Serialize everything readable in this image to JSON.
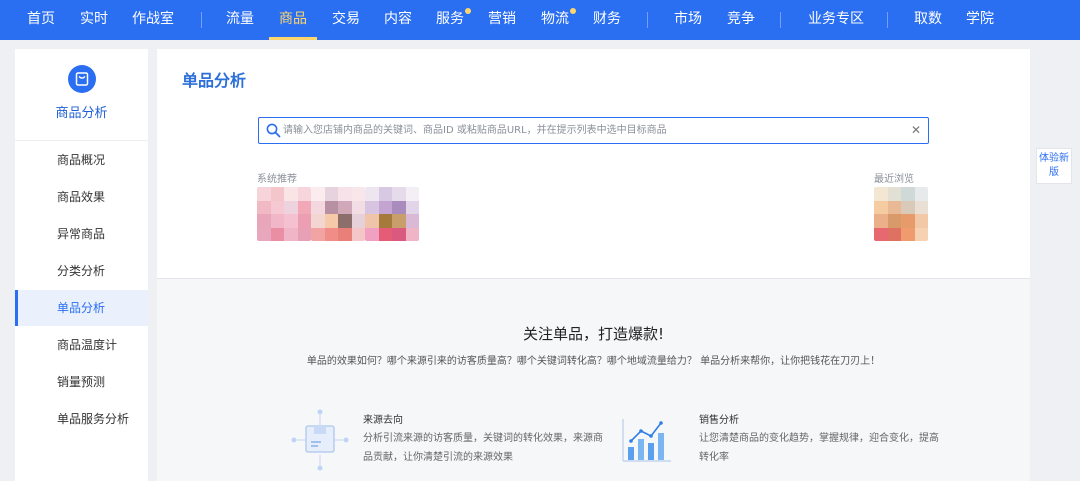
{
  "topnav": {
    "items": [
      {
        "label": "首页",
        "dot": false,
        "active": false
      },
      {
        "label": "实时",
        "dot": false,
        "active": false
      },
      {
        "label": "作战室",
        "dot": false,
        "active": false
      },
      {
        "label": "流量",
        "dot": false,
        "active": false
      },
      {
        "label": "商品",
        "dot": false,
        "active": true
      },
      {
        "label": "交易",
        "dot": false,
        "active": false
      },
      {
        "label": "内容",
        "dot": false,
        "active": false
      },
      {
        "label": "服务",
        "dot": true,
        "active": false
      },
      {
        "label": "营销",
        "dot": false,
        "active": false
      },
      {
        "label": "物流",
        "dot": true,
        "active": false
      },
      {
        "label": "财务",
        "dot": false,
        "active": false
      },
      {
        "label": "市场",
        "dot": false,
        "active": false
      },
      {
        "label": "竞争",
        "dot": false,
        "active": false
      },
      {
        "label": "业务专区",
        "dot": false,
        "active": false
      },
      {
        "label": "取数",
        "dot": false,
        "active": false
      },
      {
        "label": "学院",
        "dot": false,
        "active": false
      }
    ]
  },
  "sidebar": {
    "title": "商品分析",
    "icon": "product-analysis-icon",
    "items": [
      {
        "label": "商品概况",
        "active": false
      },
      {
        "label": "商品效果",
        "active": false
      },
      {
        "label": "异常商品",
        "active": false
      },
      {
        "label": "分类分析",
        "active": false
      },
      {
        "label": "单品分析",
        "active": true
      },
      {
        "label": "商品温度计",
        "active": false
      },
      {
        "label": "销量预测",
        "active": false
      },
      {
        "label": "单品服务分析",
        "active": false
      }
    ]
  },
  "main": {
    "title": "单品分析",
    "search": {
      "placeholder": "请输入您店铺内商品的关键词、商品ID 或粘贴商品URL，并在提示列表中选中目标商品",
      "value": ""
    },
    "recommend_label": "系统推荐",
    "recent_label": "最近浏览",
    "promo_title": "关注单品，打造爆款!",
    "promo_subtitle": "单品的效果如何？哪个来源引来的访客质量高？哪个关键词转化高？哪个地域流量给力？ 单品分析来帮你，让你把钱花在刀刃上！",
    "features": [
      {
        "title": "来源去向",
        "desc": "分析引流来源的访客质量，关键词的转化效果，来源商品贡献，让你清楚引流的来源效果",
        "icon": "source-box-icon"
      },
      {
        "title": "销售分析",
        "desc": "让您清楚商品的变化趋势，掌握规律，迎合变化，提高转化率",
        "icon": "sales-chart-icon"
      }
    ]
  },
  "experience_button": {
    "label": "体验新版"
  },
  "colors": {
    "brand": "#2a6ef2",
    "active_tab": "#ffd66b",
    "title": "#2d6fd9"
  }
}
